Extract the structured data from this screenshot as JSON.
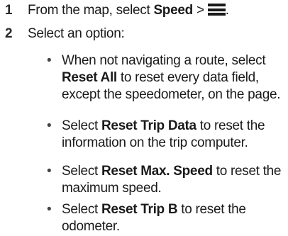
{
  "steps": [
    {
      "number": "1",
      "text_before": "From the map, select ",
      "bold": "Speed",
      "separator": " > ",
      "icon": "menu-icon",
      "text_after": "."
    },
    {
      "number": "2",
      "text": "Select an option:"
    }
  ],
  "options": [
    {
      "bullet": "•",
      "line1_before": "When not navigating a route, select",
      "line2_bold": "Reset All",
      "line2_after": " to reset every data field,",
      "line3": "except the speedometer, on the page."
    },
    {
      "bullet": "•",
      "line1_before": "Select ",
      "line1_bold": "Reset Trip Data",
      "line1_after": " to reset the",
      "line2": "information on the trip computer."
    },
    {
      "bullet": "•",
      "line1_before": "Select ",
      "line1_bold": "Reset Max. Speed",
      "line1_after": " to reset the",
      "line2": "maximum speed."
    },
    {
      "bullet": "•",
      "line1_before": "Select ",
      "line1_bold": "Reset Trip B",
      "line1_after": " to reset the",
      "line2": "odometer."
    }
  ]
}
